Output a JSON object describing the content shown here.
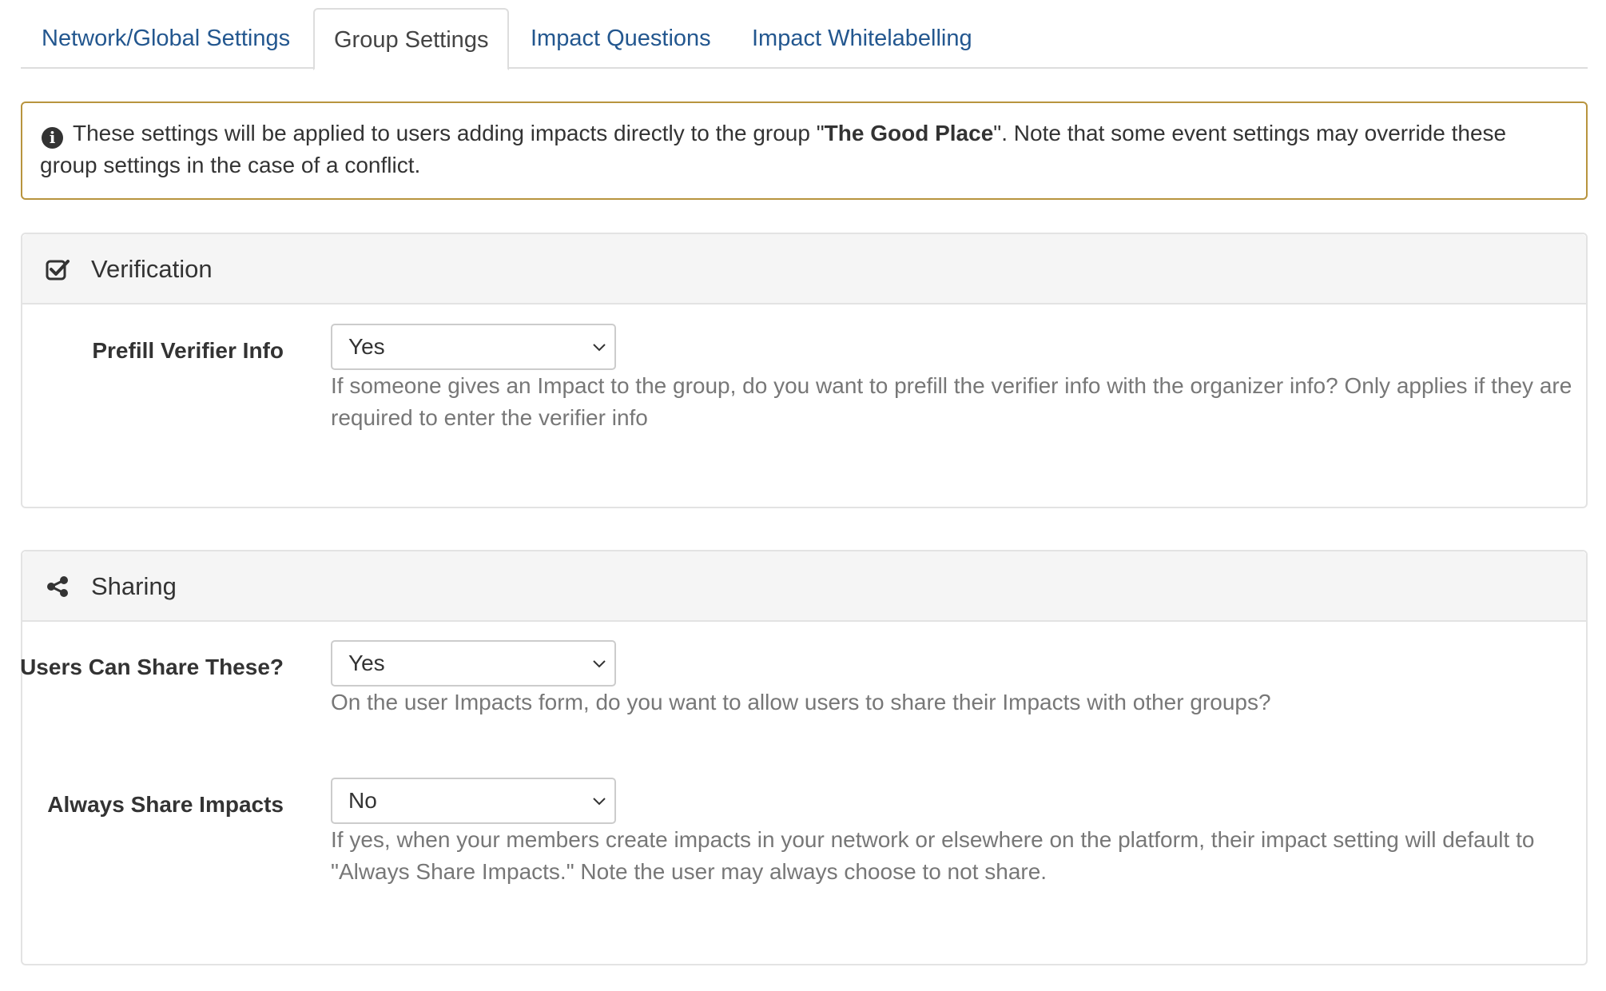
{
  "tabs": [
    {
      "label": "Network/Global Settings",
      "active": false
    },
    {
      "label": "Group Settings",
      "active": true
    },
    {
      "label": "Impact Questions",
      "active": false
    },
    {
      "label": "Impact Whitelabelling",
      "active": false
    }
  ],
  "alert": {
    "icon": "info-circle-icon",
    "text_before": "These settings will be applied to users adding impacts directly to the group \"",
    "group_name": "The Good Place",
    "text_after": "\". Note that some event settings may override these group settings in the case of a conflict."
  },
  "verification": {
    "icon": "check-square-icon",
    "title": "Verification",
    "prefill": {
      "label": "Prefill Verifier Info",
      "value": "Yes",
      "help": "If someone gives an Impact to the group, do you want to prefill the verifier info with the organizer info? Only applies if they are required to enter the verifier info"
    }
  },
  "sharing": {
    "icon": "share-icon",
    "title": "Sharing",
    "users_can_share": {
      "label": "Users Can Share These?",
      "value": "Yes",
      "help": "On the user Impacts form, do you want to allow users to share their Impacts with other groups?"
    },
    "always_share": {
      "label": "Always Share Impacts",
      "value": "No",
      "help": "If yes, when your members create impacts in your network or elsewhere on the platform, their impact setting will default to \"Always Share Impacts.\" Note the user may always choose to not share."
    }
  },
  "colors": {
    "link": "#23578f",
    "alert_border": "#b8943e",
    "panel_head_bg": "#f5f5f5",
    "help_text": "#777777"
  }
}
